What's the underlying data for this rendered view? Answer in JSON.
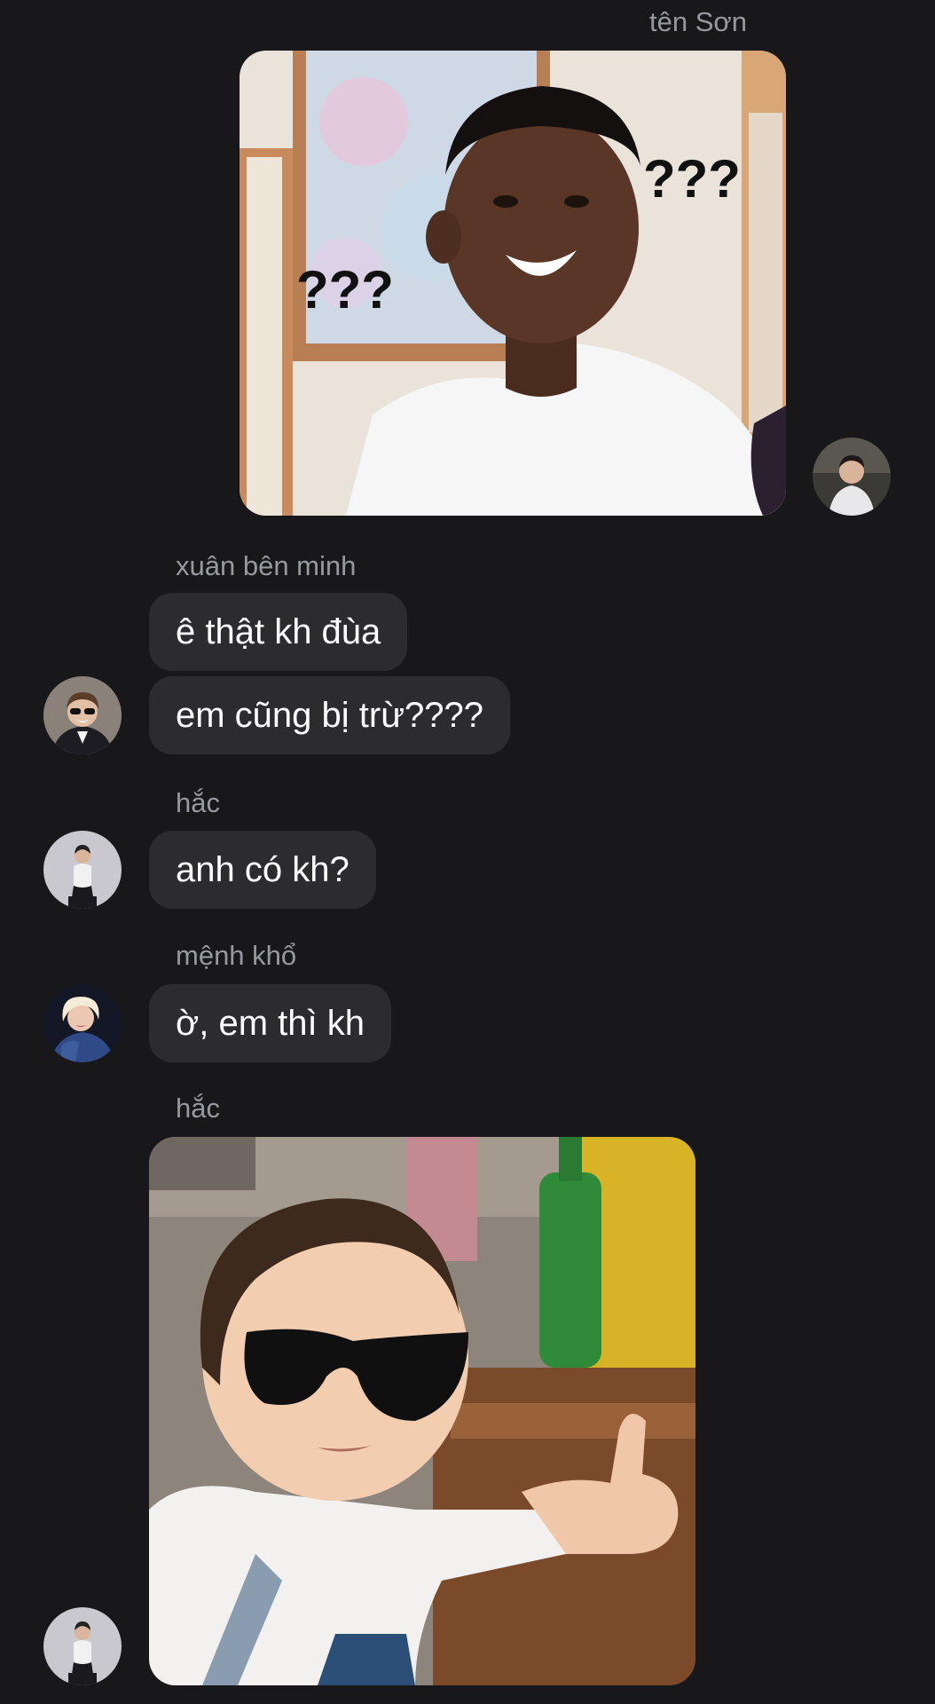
{
  "messages": [
    {
      "sender": "tên Sơn",
      "type": "image",
      "image_desc": "meme-confused-man",
      "overlay_text_left": "???",
      "overlay_text_right": "???"
    },
    {
      "sender": "xuân bên minh",
      "type": "text",
      "texts": [
        "ê thật kh đùa",
        "em cũng bị trừ????"
      ]
    },
    {
      "sender": "hắc",
      "type": "text",
      "texts": [
        "anh có kh?"
      ]
    },
    {
      "sender": "mệnh khổ",
      "type": "text",
      "texts": [
        "ờ, em thì kh"
      ]
    },
    {
      "sender": "hắc",
      "type": "image",
      "image_desc": "meme-baby-sunglasses-thumbs-up"
    }
  ],
  "colors": {
    "background": "#18181b",
    "bubble": "#2c2c2f",
    "sender_name": "#98989f",
    "text": "#ffffff"
  }
}
